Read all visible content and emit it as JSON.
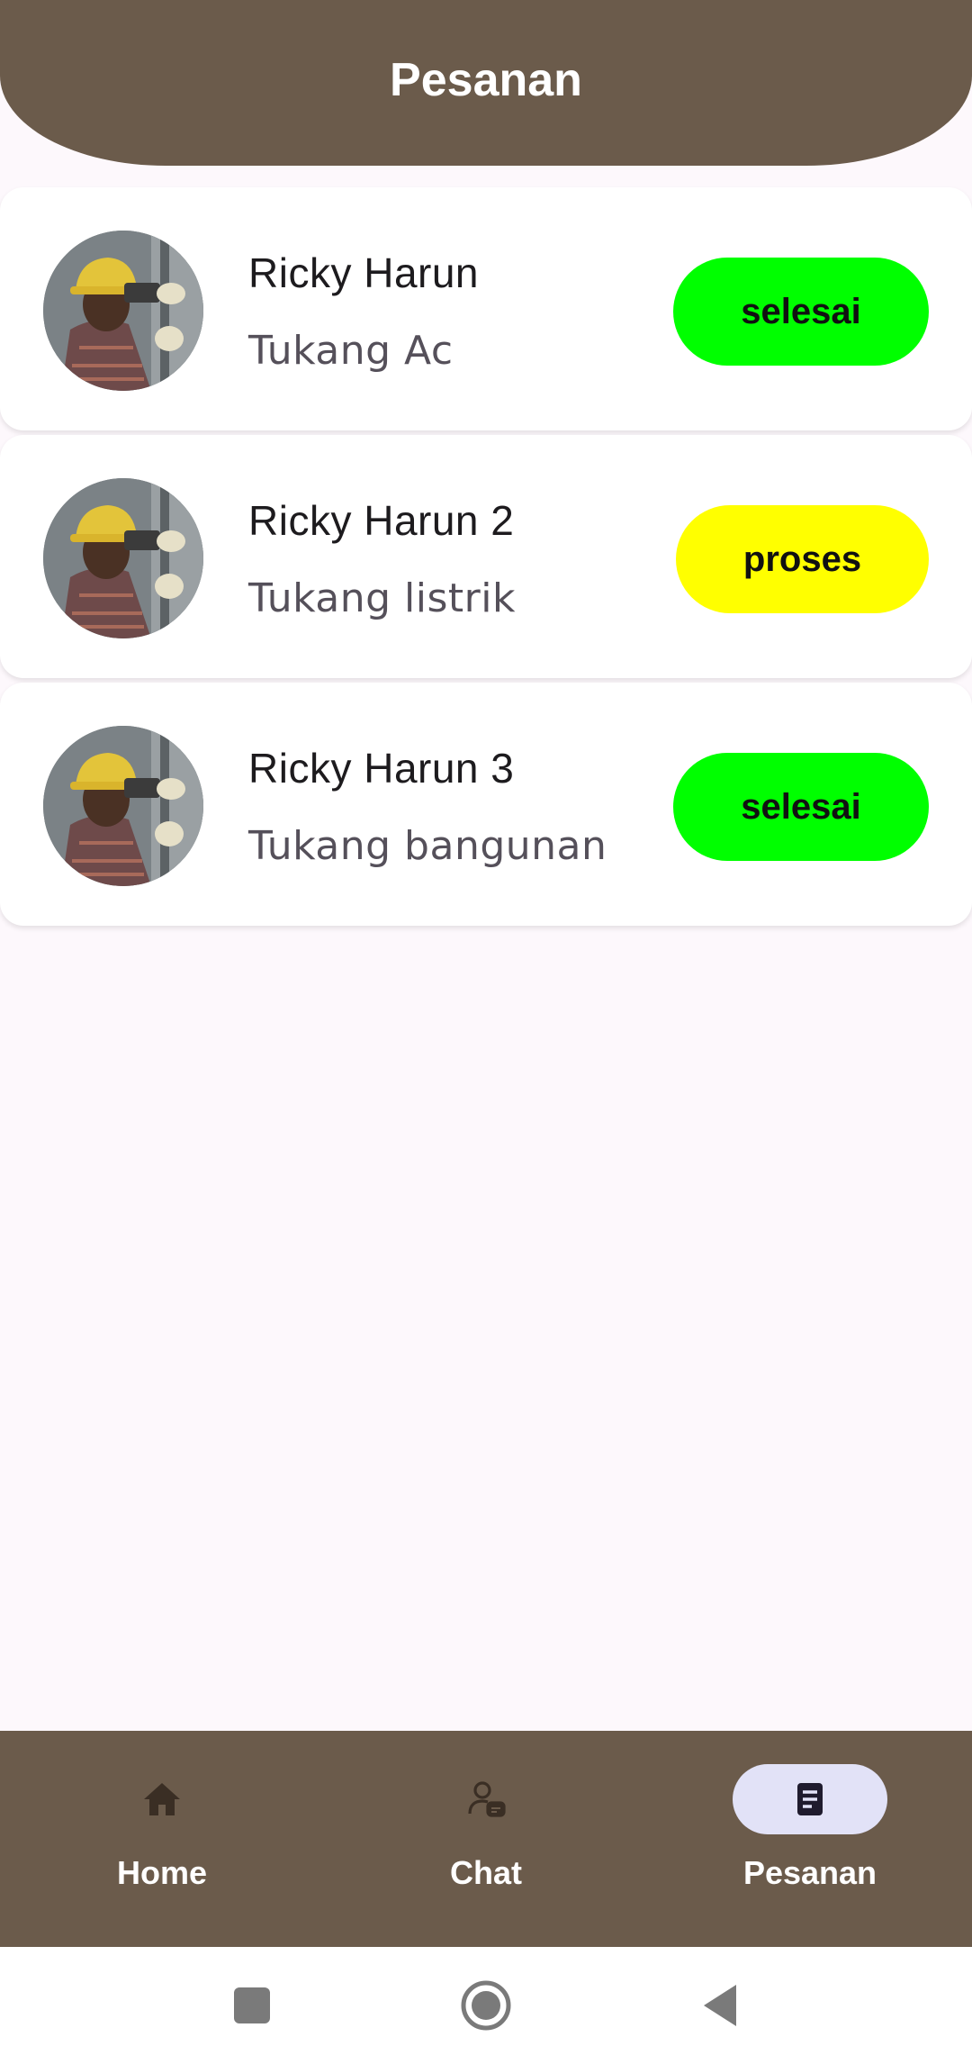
{
  "header": {
    "title": "Pesanan"
  },
  "orders": [
    {
      "name": "Ricky Harun",
      "job": "Tukang Ac",
      "status": "selesai",
      "status_color": "#00FF00"
    },
    {
      "name": "Ricky Harun 2",
      "job": "Tukang listrik",
      "status": "proses",
      "status_color": "#FFFF00"
    },
    {
      "name": "Ricky Harun 3",
      "job": "Tukang bangunan",
      "status": "selesai",
      "status_color": "#00FF00"
    }
  ],
  "bottom_nav": {
    "items": [
      {
        "label": "Home",
        "icon": "home-icon",
        "active": false
      },
      {
        "label": "Chat",
        "icon": "chat-person-icon",
        "active": false
      },
      {
        "label": "Pesanan",
        "icon": "document-icon",
        "active": true
      }
    ]
  },
  "system_nav": {
    "icons": [
      "recents-square-icon",
      "home-circle-icon",
      "back-triangle-icon"
    ]
  },
  "colors": {
    "primary_brown": "#6B5B4B",
    "background": "#FDF8FC",
    "active_pill": "#E2E2F7",
    "status_done": "#00FF00",
    "status_process": "#FFFF00"
  }
}
